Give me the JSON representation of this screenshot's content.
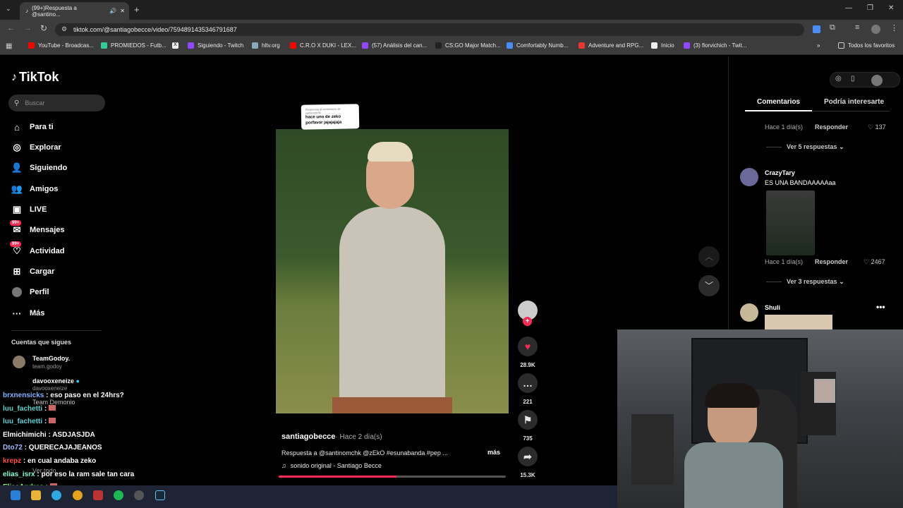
{
  "browser": {
    "tab_title": "(99+)Respuesta a @santino...",
    "url": "tiktok.com/@santiagobecce/video/7594891435346791687",
    "bookmarks": [
      "YouTube - Broadcas...",
      "PROMIEDOS - Futb...",
      "Siguiendo - Twitch",
      "hltv.org",
      "C.R.O X DUKI - LEX...",
      "(57) Análisis del can...",
      "CS:GO Major Match...",
      "Comfortably Numb...",
      "Adventure and RPG...",
      "Inicio",
      "(3) florvichich - Twit..."
    ],
    "all_favorites": "Todos los favoritos"
  },
  "sidebar": {
    "logo": "TikTok",
    "search_placeholder": "Buscar",
    "nav": [
      {
        "label": "Para ti"
      },
      {
        "label": "Explorar"
      },
      {
        "label": "Siguiendo"
      },
      {
        "label": "Amigos"
      },
      {
        "label": "LIVE"
      },
      {
        "label": "Mensajes",
        "badge": "99+"
      },
      {
        "label": "Actividad",
        "badge": "99+"
      },
      {
        "label": "Cargar"
      },
      {
        "label": "Perfil"
      },
      {
        "label": "Más"
      }
    ],
    "following_title": "Cuentas que sigues",
    "following": [
      {
        "name": "TeamGodoy.",
        "handle": "team.godoy"
      },
      {
        "name": "davooxeneize",
        "handle": "davooxeneize"
      },
      {
        "name": "Team Demonio",
        "handle": ""
      }
    ],
    "see_all": "Ver todo"
  },
  "video": {
    "reply_caption": "Respuesta al comentario de santinomchk",
    "reply_text": "hace uno de zeko porfavor jajajajaja",
    "author": "santiagobecce",
    "time": "· Hace 2 día(s)",
    "desc": "Respuesta a @santinomchk @zEkO #esunabanda #pep ...",
    "more": "más",
    "sound": "sonido original - Santiago Becce"
  },
  "actions": {
    "likes": "28.9K",
    "comments": "221",
    "saves": "735",
    "shares": "15.3K"
  },
  "comments_panel": {
    "tabs": [
      "Comentarios",
      "Podría interesarte"
    ],
    "c1": {
      "time": "Hace 1 día(s)",
      "reply": "Responder",
      "likes": "137",
      "more": "Ver 5 respuestas"
    },
    "c2": {
      "user": "CrazyTary",
      "text": "ES UNA BANDAAAAAaa",
      "time": "Hace 1 día(s)",
      "reply": "Responder",
      "likes": "2467",
      "more": "Ver 3 respuestas"
    },
    "c3": {
      "user": "Shuli"
    }
  },
  "chat": [
    {
      "user": "brxnensicks",
      "msg": "eso paso en el 24hrs?",
      "color": "#7fb2ff"
    },
    {
      "user": "luu_fachetti",
      "msg": "",
      "color": "#5bd0d0"
    },
    {
      "user": "luu_fachetti",
      "msg": "",
      "color": "#5bd0d0"
    },
    {
      "user": "Elmichimichi",
      "msg": "ASDJASJDA",
      "color": "#ffffff"
    },
    {
      "user": "Dto72",
      "msg": "QUERECAJAJEANOS",
      "color": "#a6b8ff"
    },
    {
      "user": "krepz",
      "msg": "en cual andaba zeko",
      "color": "#ff4a4a"
    },
    {
      "user": "elias_isrx",
      "msg": "por eso la ram sale tan cara",
      "color": "#7fffd4"
    },
    {
      "user": "EliasAndres",
      "msg": "",
      "color": "#7cfc7c"
    }
  ]
}
